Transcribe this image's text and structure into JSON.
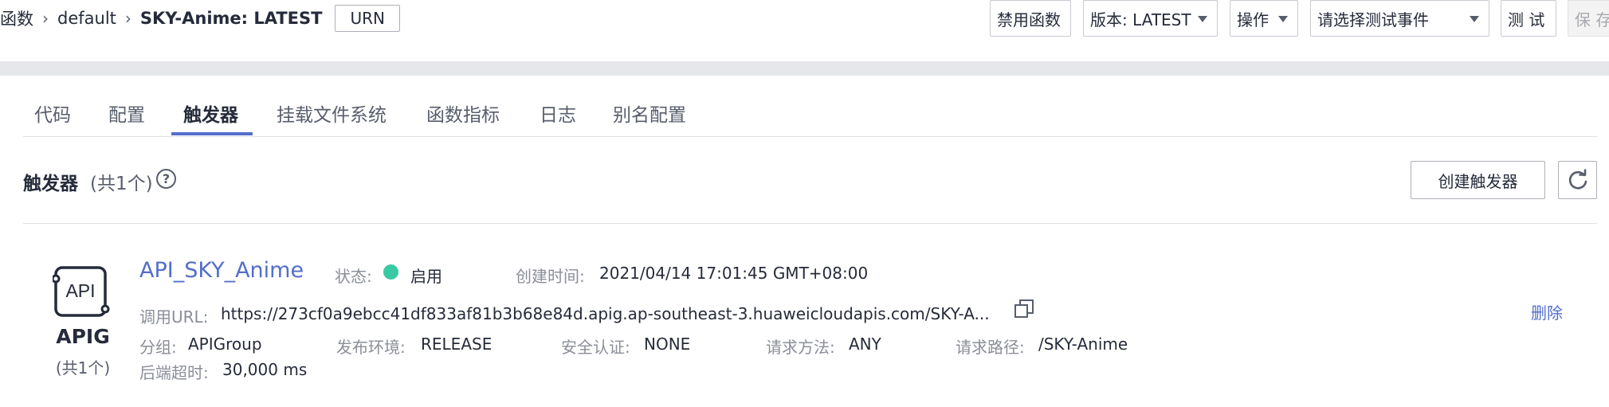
{
  "breadcrumb": {
    "parent": "函数",
    "mid": "default",
    "current": "SKY-Anime: LATEST",
    "urn_button": "URN"
  },
  "toolbar": {
    "disable_button": "禁用函数",
    "version_select": "版本: LATEST",
    "ops_select": "操作",
    "test_event_select": "请选择测试事件",
    "test_button": "测 试",
    "save_button": "保 存"
  },
  "tabs": [
    {
      "label": "代码",
      "active": false
    },
    {
      "label": "配置",
      "active": false
    },
    {
      "label": "触发器",
      "active": true
    },
    {
      "label": "挂载文件系统",
      "active": false
    },
    {
      "label": "函数指标",
      "active": false
    },
    {
      "label": "日志",
      "active": false
    },
    {
      "label": "别名配置",
      "active": false
    }
  ],
  "section": {
    "title": "触发器",
    "count": "(共1个)",
    "help_glyph": "?",
    "create_button": "创建触发器"
  },
  "trigger": {
    "type_label": "APIG",
    "type_count": "(共1个)",
    "type_icon_text": "API",
    "name": "API_SKY_Anime",
    "status_label": "状态:",
    "status_value": "启用",
    "status_color": "#3bc9a4",
    "created_label": "创建时间:",
    "created_value": "2021/04/14 17:01:45 GMT+08:00",
    "url_label": "调用URL:",
    "url_value": "https://273cf0a9ebcc41df833af81b3b68e84d.apig.ap-southeast-3.huaweicloudapis.com/SKY-A...",
    "group_label": "分组:",
    "group_value": "APIGroup",
    "env_label": "发布环境:",
    "env_value": "RELEASE",
    "auth_label": "安全认证:",
    "auth_value": "NONE",
    "method_label": "请求方法:",
    "method_value": "ANY",
    "path_label": "请求路径:",
    "path_value": "/SKY-Anime",
    "timeout_label": "后端超时:",
    "timeout_value": "30,000 ms",
    "delete_link": "删除"
  },
  "colors": {
    "accent": "#526ecc",
    "text_primary": "#252b3a",
    "text_secondary": "#8a8e99",
    "band": "#e6e7eb"
  }
}
